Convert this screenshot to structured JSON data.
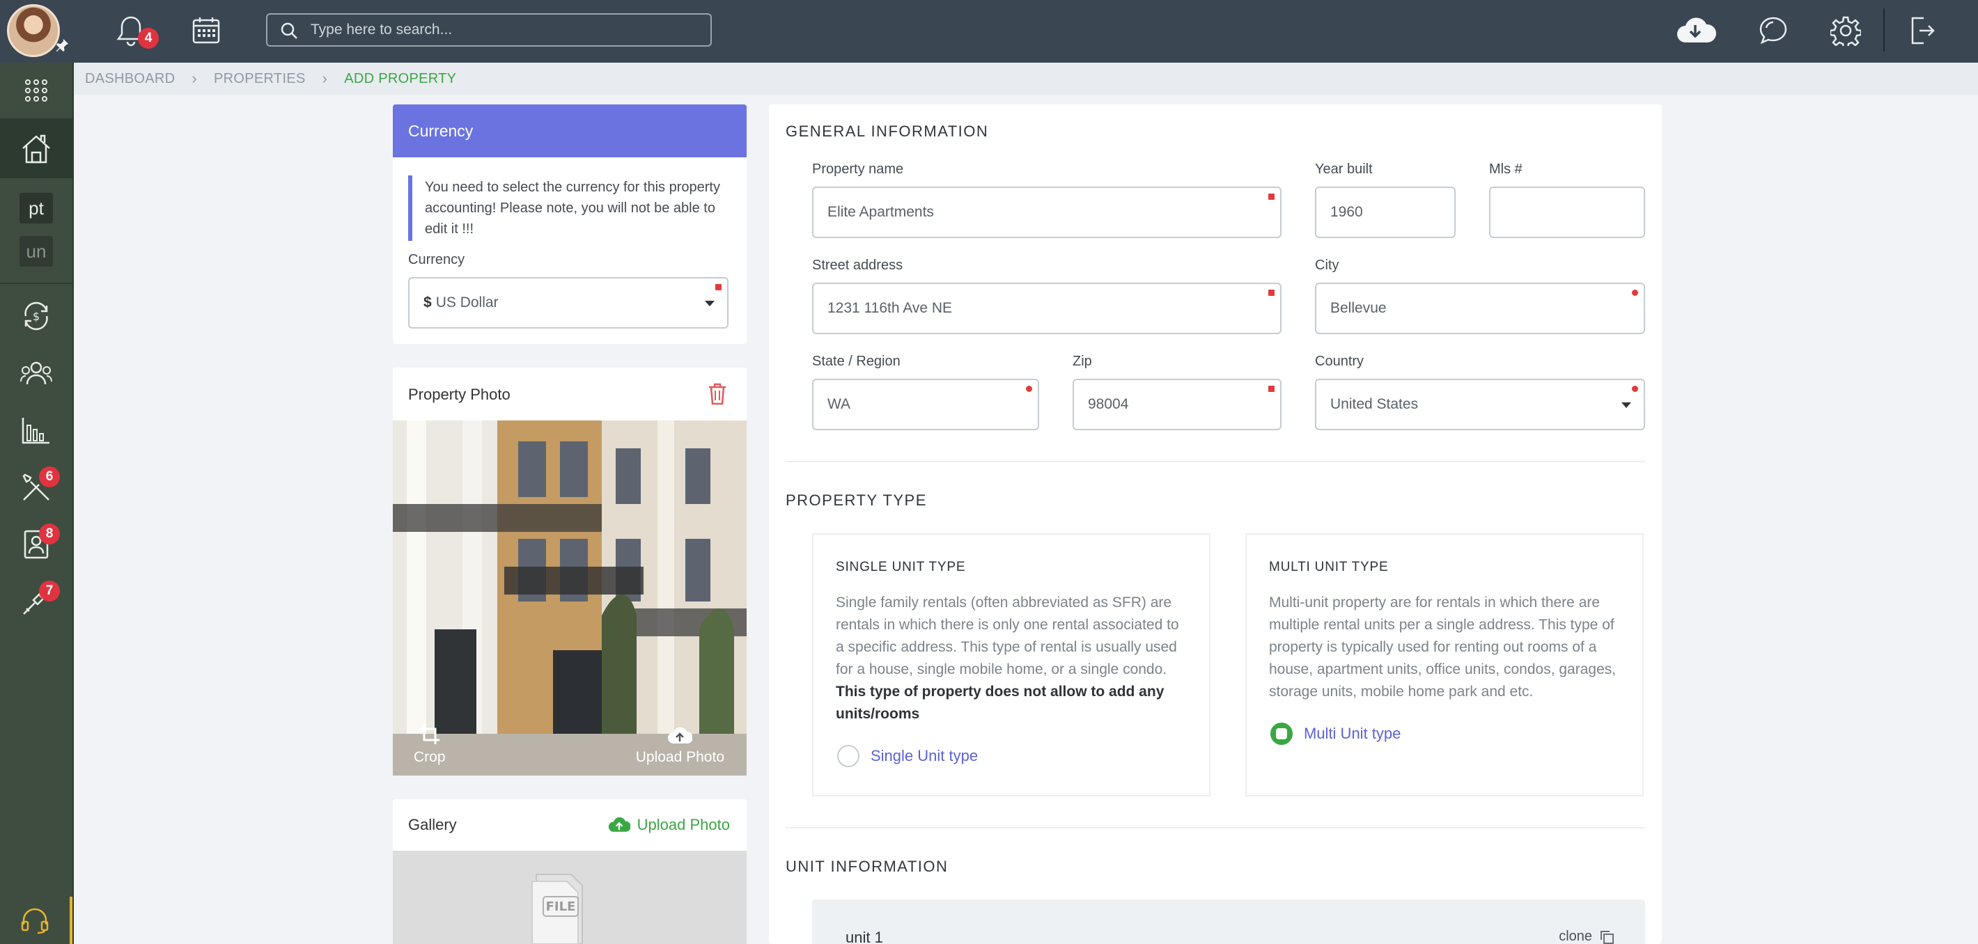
{
  "topbar": {
    "notifications_count": "4",
    "search_placeholder": "Type here to search..."
  },
  "sidebar": {
    "tag_pt": "pt",
    "tag_un": "un",
    "maintenance_count": "6",
    "contacts_count": "8",
    "tools_count": "7"
  },
  "breadcrumb": {
    "items": [
      "DASHBOARD",
      "PROPERTIES"
    ],
    "current": "ADD PROPERTY"
  },
  "currency": {
    "header": "Currency",
    "notice": "You need to select the currency for this property accounting! Please note, you will not be able to edit it !!!",
    "label": "Currency",
    "symbol": "$",
    "value": "US Dollar"
  },
  "photo": {
    "title": "Property Photo",
    "crop_label": "Crop",
    "upload_label": "Upload Photo"
  },
  "gallery": {
    "title": "Gallery",
    "upload_label": "Upload Photo",
    "file_icon_text": "FILE"
  },
  "general": {
    "title": "GENERAL INFORMATION",
    "property_name_label": "Property name",
    "property_name": "Elite Apartments",
    "year_built_label": "Year built",
    "year_built": "1960",
    "mls_label": "Mls #",
    "mls": "",
    "street_label": "Street address",
    "street": "1231 116th Ave NE",
    "city_label": "City",
    "city": "Bellevue",
    "state_label": "State / Region",
    "state": "WA",
    "zip_label": "Zip",
    "zip": "98004",
    "country_label": "Country",
    "country": "United States"
  },
  "property_type": {
    "title": "PROPERTY TYPE",
    "single": {
      "title": "SINGLE UNIT TYPE",
      "desc": "Single family rentals (often abbreviated as SFR) are rentals in which there is only one rental associated to a specific address. This type of rental is usually used for a house, single mobile home, or a single condo.",
      "desc_bold": "This type of property does not allow to add any units/rooms",
      "option_label": "Single Unit type",
      "selected": false
    },
    "multi": {
      "title": "MULTI UNIT TYPE",
      "desc": "Multi-unit property are for rentals in which there are multiple rental units per a single address. This type of property is typically used for renting out rooms of a house, apartment units, office units, condos, garages, storage units, mobile home park and etc.",
      "option_label": "Multi Unit type",
      "selected": true
    }
  },
  "unit_info": {
    "title": "UNIT INFORMATION",
    "unit_name": "unit 1",
    "clone_label": "clone"
  },
  "colors": {
    "topbar": "#3a4651",
    "sidebar": "#3f4c40",
    "accent_purple": "#6a73e0",
    "accent_green": "#3aa744",
    "badge_red": "#e03340"
  }
}
